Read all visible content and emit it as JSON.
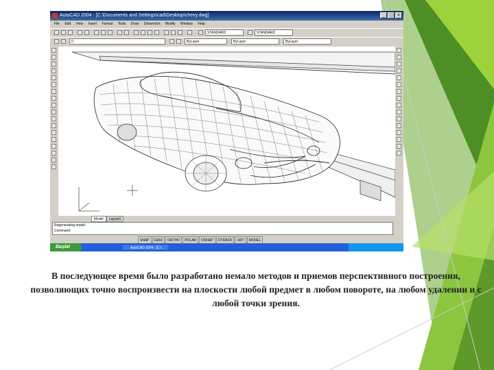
{
  "window": {
    "title": "AutoCAD 2004 - [C:\\Documents and Settings\\cad\\Desktop\\chevy.dwg]",
    "buttons": [
      "_",
      "□",
      "×"
    ]
  },
  "menu": [
    "File",
    "Edit",
    "View",
    "Insert",
    "Format",
    "Tools",
    "Draw",
    "Dimension",
    "Modify",
    "Window",
    "Help"
  ],
  "toolbar": {
    "text_style": "STANDARD",
    "dim_style": "STANDARD",
    "layer": "0",
    "color": "ByLayer",
    "linetype": "ByLayer",
    "lineweight": "ByLayer"
  },
  "tabs": [
    "Model",
    "Layout1"
  ],
  "command": {
    "line1": "Regenerating model.",
    "line2": "Command:"
  },
  "status_modes": [
    "SNAP",
    "GRID",
    "ORTHO",
    "POLAR",
    "OSNAP",
    "OTRACK",
    "LWT",
    "MODEL"
  ],
  "taskbar": {
    "start": "Başlat",
    "task": "AutoCAD 2004 - [C:\\..."
  },
  "caption": "В последующее время было разработано немало методов и приемов перспективного построения, позволяющих точно воспроизвести на плоскости любой предмет в любом повороте, на любом удалении и с любой точки зрения.",
  "colors": {
    "green_dark": "#5e9a2a",
    "green_light": "#9ed23c",
    "title_blue": "#0a246a"
  }
}
